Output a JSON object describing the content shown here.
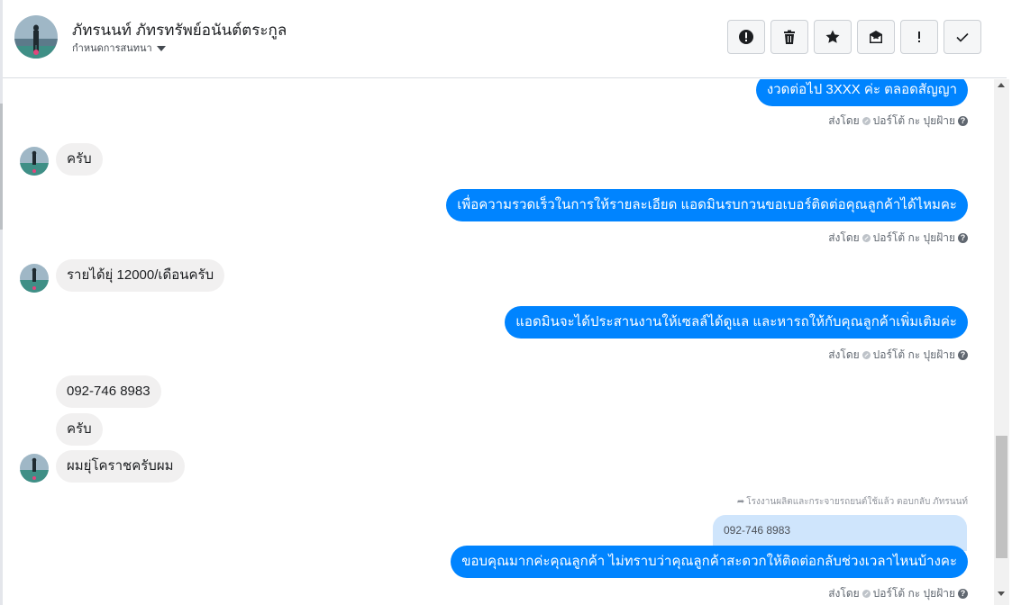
{
  "header": {
    "contact_name": "ภัทรนนท์ ภัทรทรัพย์อนันต์ตระกูล",
    "assign_label": "กำหนดการสนทนา",
    "actions": [
      {
        "name": "report-spam-button",
        "icon": "exclamation-circle-icon"
      },
      {
        "name": "delete-button",
        "icon": "trash-icon"
      },
      {
        "name": "star-button",
        "icon": "star-icon"
      },
      {
        "name": "mark-unread-button",
        "icon": "envelope-x-icon"
      },
      {
        "name": "follow-up-button",
        "icon": "exclamation-icon"
      },
      {
        "name": "done-button",
        "icon": "check-icon"
      }
    ]
  },
  "colors": {
    "outgoing_bubble": "#0084ff",
    "incoming_bubble": "#f1f0f0",
    "quoted_bubble": "#cfe5fc"
  },
  "messages": [
    {
      "direction": "out",
      "text": "งวดต่อไป 3XXX ค่ะ ตลอดสัญญา",
      "meta": "ส่งโดย",
      "sender": "ปอร์โต้ กะ ปุยฝ้าย"
    },
    {
      "direction": "in",
      "text": "ครับ"
    },
    {
      "direction": "out",
      "text": "เพื่อความรวดเร็วในการให้รายละเอียด แอดมินรบกวนขอเบอร์ติดต่อคุณลูกค้าได้ไหมคะ",
      "meta": "ส่งโดย",
      "sender": "ปอร์โต้ กะ ปุยฝ้าย"
    },
    {
      "direction": "in",
      "text": "รายได้ยุ่ 12000/เดือนครับ"
    },
    {
      "direction": "out",
      "text": "แอดมินจะได้ประสานงานให้เซลล์ได้ดูแล และหารถให้กับคุณลูกค้าเพิ่มเติมค่ะ",
      "meta": "ส่งโดย",
      "sender": "ปอร์โต้ กะ ปุยฝ้าย"
    },
    {
      "direction": "in",
      "text": "092-746 8983"
    },
    {
      "direction": "in",
      "text": "ครับ"
    },
    {
      "direction": "in",
      "text": "ผมยุ่โคราชครับผม"
    },
    {
      "direction": "out",
      "text": "ขอบคุณมากค่ะคุณลูกค้า ไม่ทราบว่าคุณลูกค้าสะดวกให้ติดต่อกลับช่วงเวลาไหนบ้างคะ",
      "meta": "ส่งโดย",
      "sender": "ปอร์โต้ กะ ปุยฝ้าย"
    }
  ],
  "reply": {
    "note": "โรงงานผลิตและกระจายรถยนต์ใช้แล้ว ตอบกลับ ภัทรนนท์",
    "quoted_text": "092-746 8983"
  }
}
